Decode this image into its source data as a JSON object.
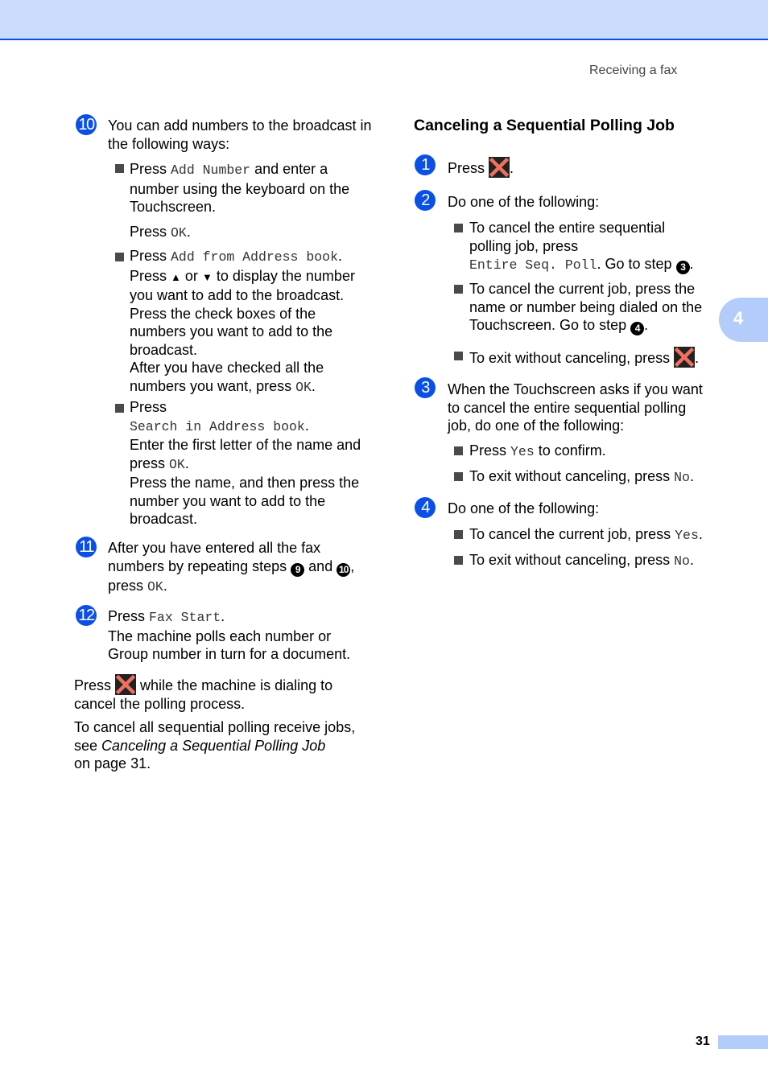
{
  "header": {
    "running_head": "Receiving a fax"
  },
  "chapter_tab": {
    "number": "4"
  },
  "footer": {
    "page_number": "31"
  },
  "colors": {
    "accent_blue": "#0a50e6",
    "band_light_blue": "#ccdcfc",
    "tab_blue": "#b4ccfa",
    "cancel_x_red": "#f07060"
  },
  "left": {
    "step10": {
      "num": "10",
      "text": "You can add numbers to the broadcast in the following ways:",
      "b1": {
        "press": "Press",
        "key": "Add Number",
        "rest1": "and enter a",
        "rest2": "number using the keyboard on the",
        "rest3": "Touchscreen.",
        "press2": "Press",
        "ok": "OK",
        "dot": "."
      },
      "b2": {
        "press": "Press",
        "key": "Add from Address book",
        "dot": ".",
        "l2a": "Press",
        "up": "▲",
        "or": "or",
        "down": "▼",
        "l2b": "to display the number",
        "l3": "you want to add to the broadcast.",
        "l4": "Press the check boxes of the",
        "l5": "numbers you want to add to the",
        "l6": "broadcast.",
        "l7": "After you have checked all the",
        "l8": "numbers you want, press",
        "ok": "OK",
        "dot2": "."
      },
      "b3": {
        "press": "Press",
        "key": "Search in Address book",
        "dot": ".",
        "l3": "Enter the first letter of the name and",
        "l4a": "press",
        "ok": "OK",
        "dot2": ".",
        "l5": "Press the name, and then press the",
        "l6": "number you want to add to the",
        "l7": "broadcast."
      }
    },
    "step11": {
      "num": "11",
      "l1": "After you have entered all the fax",
      "l2a": "numbers by repeating steps",
      "ref1": "9",
      "and": "and",
      "ref2": "10",
      "comma": ",",
      "l3a": "press",
      "ok": "OK",
      "dot": "."
    },
    "step12": {
      "num": "12",
      "press": "Press",
      "key": "Fax Start",
      "dot": ".",
      "l2": "The machine polls each number or",
      "l3": "Group number in turn for a document."
    },
    "note1": {
      "press": "Press",
      "rest1": "while the machine is dialing to",
      "l2": "cancel the polling process."
    },
    "note2": {
      "l1": "To cancel all sequential polling receive jobs,",
      "l2a": "see",
      "link": "Canceling a Sequential Polling Job",
      "l3": "on page 31."
    }
  },
  "right": {
    "heading": "Canceling a Sequential Polling Job",
    "step1": {
      "num": "1",
      "press": "Press",
      "dot": "."
    },
    "step2": {
      "num": "2",
      "text": "Do one of the following:",
      "b1": {
        "l1": "To cancel the entire sequential",
        "l2": "polling job, press",
        "key": "Entire Seq. Poll",
        "dot": ".",
        "goto": "Go to step",
        "ref": "3",
        "dot2": "."
      },
      "b2": {
        "l1": "To cancel the current job, press the",
        "l2": "name or number being dialed on the",
        "l3": "Touchscreen. Go to step",
        "ref": "4",
        "dot": "."
      },
      "b3": {
        "l1": "To exit without canceling, press",
        "dot": "."
      }
    },
    "step3": {
      "num": "3",
      "l1": "When the Touchscreen asks if you want",
      "l2": "to cancel the entire sequential polling",
      "l3": "job, do one of the following:",
      "b1": {
        "press": "Press",
        "key": "Yes",
        "rest": "to confirm."
      },
      "b2": {
        "text": "To exit without canceling, press",
        "key": "No",
        "dot": "."
      }
    },
    "step4": {
      "num": "4",
      "text": "Do one of the following:",
      "b1": {
        "text": "To cancel the current job, press",
        "key": "Yes",
        "dot": "."
      },
      "b2": {
        "text": "To exit without canceling, press",
        "key": "No",
        "dot": "."
      }
    }
  }
}
